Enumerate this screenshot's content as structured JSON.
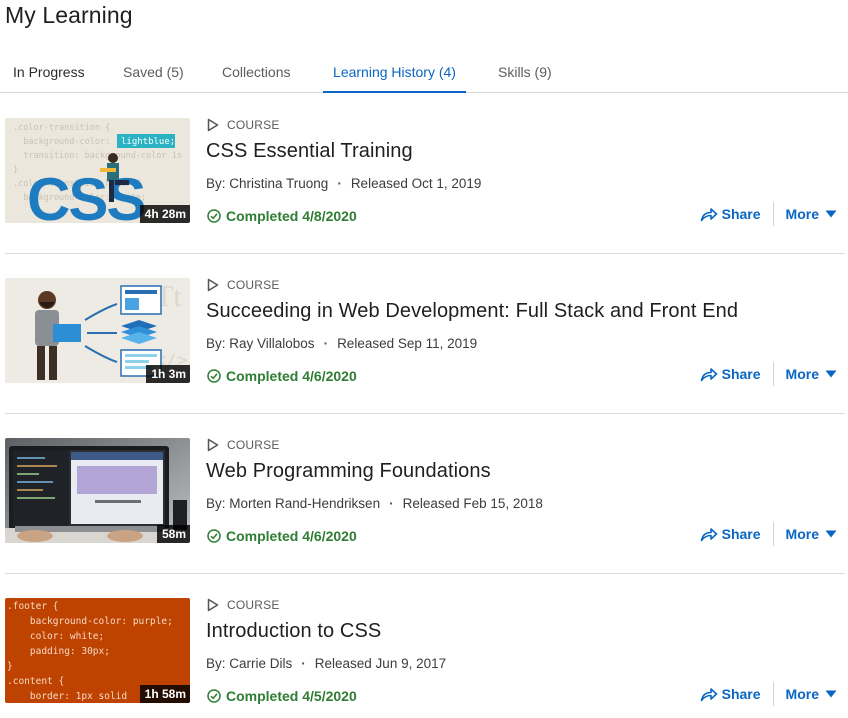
{
  "page": {
    "title": "My Learning"
  },
  "tabs": [
    {
      "label": "In Progress"
    },
    {
      "label": "Saved (5)"
    },
    {
      "label": "Collections"
    },
    {
      "label": "Learning History (4)"
    },
    {
      "label": "Skills (9)"
    }
  ],
  "active_tab": "Learning History (4)",
  "accent_color": "#0a66c2",
  "completed_color": "#2e7d32",
  "courses": [
    {
      "type": "COURSE",
      "title": "CSS Essential Training",
      "author": "By: Christina Truong",
      "released": "Released Oct 1, 2019",
      "duration": "4h 28m",
      "completed": "Completed 4/8/2020",
      "share_label": "Share",
      "more_label": "More",
      "thumb_code": [
        ".color-transition {",
        "  background-color: lightblue;",
        "  transition: background-color 1s",
        "}",
        ".color-transition:hover {",
        "  background-color: white;"
      ],
      "thumb_highlight": "lightblue;",
      "thumb_text": "CSS"
    },
    {
      "type": "COURSE",
      "title": "Succeeding in Web Development: Full Stack and Front End",
      "author": "By: Ray Villalobos",
      "released": "Released Sep 11, 2019",
      "duration": "1h 3m",
      "completed": "Completed 4/6/2020",
      "share_label": "Share",
      "more_label": "More"
    },
    {
      "type": "COURSE",
      "title": "Web Programming Foundations",
      "author": "By: Morten Rand-Hendriksen",
      "released": "Released Feb 15, 2018",
      "duration": "58m",
      "completed": "Completed 4/6/2020",
      "share_label": "Share",
      "more_label": "More"
    },
    {
      "type": "COURSE",
      "title": "Introduction to CSS",
      "author": "By: Carrie Dils",
      "released": "Released Jun 9, 2017",
      "duration": "1h 58m",
      "completed": "Completed 4/5/2020",
      "share_label": "Share",
      "more_label": "More",
      "thumb_code": [
        ".footer {",
        "    background-color: purple;",
        "    color: white;",
        "    padding: 30px;",
        "}",
        ".content {",
        "    border: 1px solid"
      ]
    }
  ]
}
